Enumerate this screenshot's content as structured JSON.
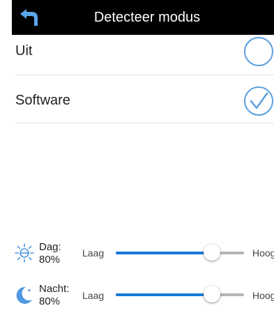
{
  "header": {
    "title": "Detecteer modus",
    "back_icon": "back-arrow-icon"
  },
  "colors": {
    "accent": "#1778d9",
    "circle": "#5a9fe0",
    "header_bg": "#000000"
  },
  "modes": [
    {
      "label": "Uit",
      "selected": false
    },
    {
      "label": "Software",
      "selected": true
    }
  ],
  "sliders": [
    {
      "name": "Dag:",
      "percent": "80%",
      "low": "Laag",
      "high": "Hoog",
      "level": 0.75,
      "icon": "sun-icon"
    },
    {
      "name": "Nacht:",
      "percent": "80%",
      "low": "Laag",
      "high": "Hoog",
      "level": 0.75,
      "icon": "moon-icon"
    }
  ]
}
